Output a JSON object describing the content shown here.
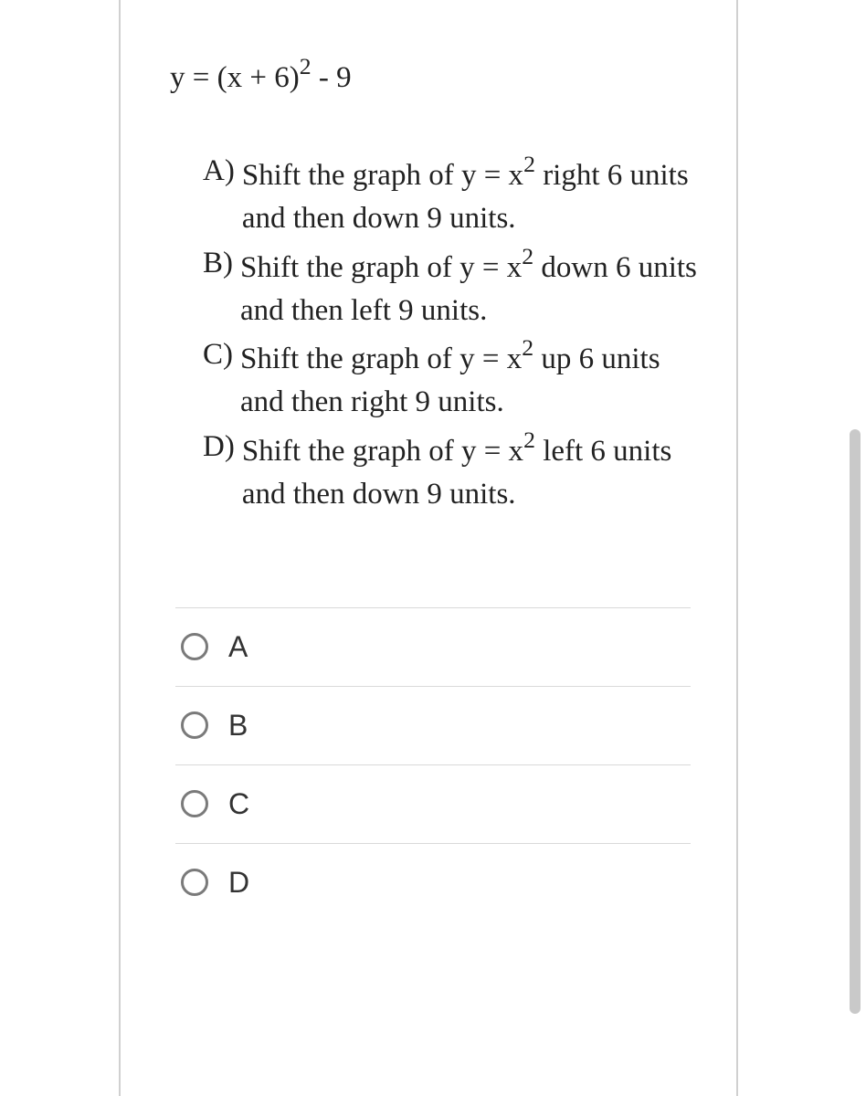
{
  "question": {
    "equation_pre": "y = (x + 6)",
    "equation_sup": "2",
    "equation_post": " - 9"
  },
  "choices": [
    {
      "letter": "A)",
      "pre": "Shift the graph of y = x",
      "sup": "2",
      "post": " right 6 units and then down 9 units."
    },
    {
      "letter": "B)",
      "pre": "Shift the graph of y = x",
      "sup": "2",
      "post": " down 6 units and then left 9 units."
    },
    {
      "letter": "C)",
      "pre": "Shift the graph of y = x",
      "sup": "2",
      "post": " up 6 units and then right 9 units."
    },
    {
      "letter": "D)",
      "pre": "Shift the graph of y = x",
      "sup": "2",
      "post": " left 6 units and then down 9 units."
    }
  ],
  "options": [
    {
      "label": "A"
    },
    {
      "label": "B"
    },
    {
      "label": "C"
    },
    {
      "label": "D"
    }
  ]
}
